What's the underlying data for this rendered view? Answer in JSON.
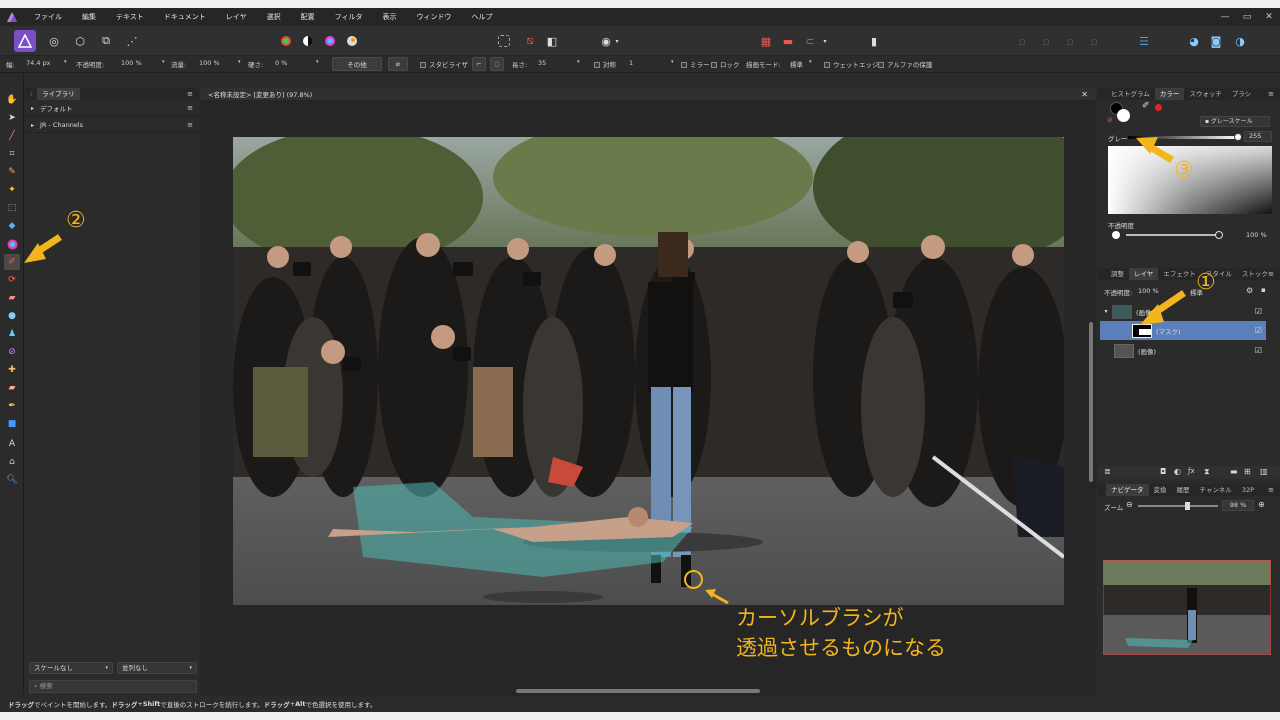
{
  "menu": [
    "ファイル",
    "編集",
    "テキスト",
    "ドキュメント",
    "レイヤ",
    "選択",
    "配置",
    "フィルタ",
    "表示",
    "ウィンドウ",
    "ヘルプ"
  ],
  "window_controls": [
    "—",
    "▭",
    "✕"
  ],
  "context": {
    "width_label": "幅:",
    "width_value": "74.4 px",
    "opacity_label": "不透明度:",
    "opacity_value": "100 %",
    "flow_label": "流量:",
    "flow_value": "100 %",
    "hardness_label": "硬さ:",
    "hardness_value": "0 %",
    "more_button": "その他",
    "stabilizer": "スタビライザ",
    "length_label": "長さ:",
    "length_value": "35",
    "symmetry_label": "対称",
    "symmetry_value": "1",
    "mirror": "ミラー",
    "lock": "ロック",
    "blend_mode_label": "描画モード:",
    "blend_mode_value": "標準",
    "wet_edges": "ウェットエッジ",
    "protect_alpha": "アルファの保護"
  },
  "library": {
    "tab": "ライブラリ",
    "items": [
      "デフォルト",
      "JR - Channels"
    ],
    "scale_select": "スケールなし",
    "sort_select": "並列なし",
    "search_placeholder": "検索"
  },
  "document": {
    "tab_title": "<名称未設定> [変更あり] (97.8%)"
  },
  "color_panel": {
    "tabs": [
      "ヒストグラム",
      "カラー",
      "スウォッチ",
      "ブラシ"
    ],
    "mode": "グレースケール",
    "gray_label": "グレー",
    "gray_value": "255",
    "opacity_label": "不透明度",
    "opacity_value": "100 %"
  },
  "layers_panel": {
    "tabs": [
      "調整",
      "レイヤ",
      "エフェクト",
      "スタイル",
      "ストック"
    ],
    "opacity_label": "不透明度:",
    "opacity_value": "100 %",
    "blend_value": "標準",
    "layers": [
      {
        "name": "(画像)",
        "selected": false,
        "indent": false
      },
      {
        "name": "(マスク)",
        "selected": true,
        "indent": true
      },
      {
        "name": "(画像)",
        "selected": false,
        "indent": false
      }
    ]
  },
  "navigator": {
    "tabs": [
      "ナビゲータ",
      "変換",
      "履歴",
      "チャンネル",
      "32P"
    ],
    "zoom_label": "ズーム",
    "zoom_value": "98 %"
  },
  "status": {
    "segments": [
      "ドラッグ",
      "でペイントを開始します。",
      "ドラッグ",
      "+",
      "Shift",
      "で直後のストロークを続行します。",
      "ドラッグ",
      "+",
      "Alt",
      "で色選択を使用します。"
    ]
  },
  "annotations": {
    "marker1": "①",
    "marker2": "②",
    "marker3": "③",
    "callout_line1": "カーソルブラシが",
    "callout_line2": "透過させるものになる",
    "color": "#f2b51c"
  },
  "colors": {
    "accent": "#4a7cc9",
    "selection": "#5b7fb8"
  }
}
